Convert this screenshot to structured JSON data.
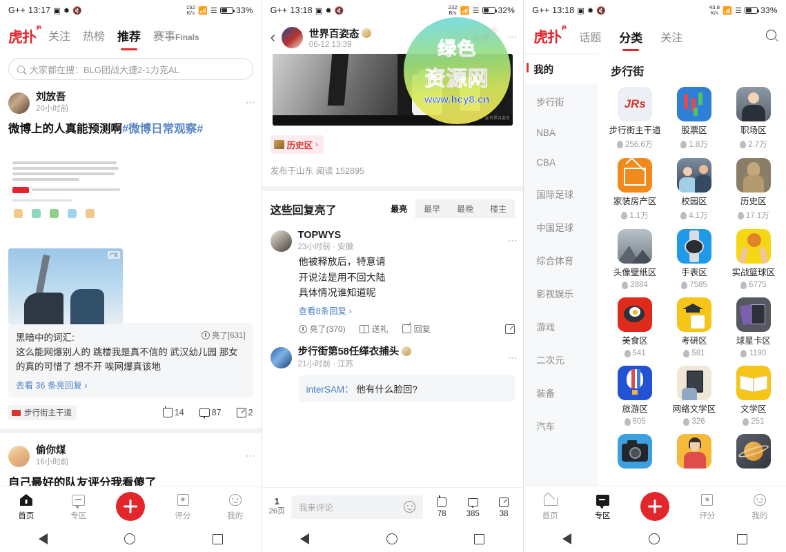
{
  "panel1": {
    "status": {
      "carrier": "G++",
      "time": "13:17",
      "net_rate": "152",
      "net_unit": "K/s",
      "battery": "33%"
    },
    "logo": {
      "text": "虎扑",
      "sup": "JR"
    },
    "tabs": [
      {
        "label": "关注",
        "active": false
      },
      {
        "label": "热榜",
        "active": false
      },
      {
        "label": "推荐",
        "active": true
      },
      {
        "label": "赛事",
        "suffix": "Finals",
        "active": false
      }
    ],
    "search": {
      "placeholder": "大家都在搜：BLG团战大捷2-1力克AL"
    },
    "post": {
      "author": "刘放吾",
      "time": "20小时前",
      "title_main": "微博上的人真能预测啊",
      "title_tag": "#微博日常观察#",
      "quote_name": "黑暗中的词汇:",
      "quote_bright": "亮了[631]",
      "quote_text": "这么能网爆别人的 跳楼我是真不信的 武汉幼儿园 那女的真的可惜了 想不开 唉网爆真该地",
      "quote_more": "去看 36 条亮回复 ",
      "zone": "步行街主干道",
      "likes": "14",
      "comments": "87",
      "shares": "2"
    },
    "post2": {
      "author": "偷你煤",
      "time": "16小时前",
      "title": "自己最好的队友评分我看傻了"
    },
    "nav": [
      {
        "label": "首页",
        "icon": "home-icon",
        "active": true
      },
      {
        "label": "专区",
        "icon": "zone-icon",
        "active": false
      },
      {
        "label": "",
        "icon": "plus-icon",
        "active": false
      },
      {
        "label": "评分",
        "icon": "star-icon",
        "active": false
      },
      {
        "label": "我的",
        "icon": "profile-icon",
        "active": false
      }
    ]
  },
  "panel2": {
    "status": {
      "carrier": "G++",
      "time": "13:18",
      "net_rate": "232",
      "net_unit": "B/s",
      "battery": "32%"
    },
    "header": {
      "author": "世界百姿态",
      "time": "06-12 13:39",
      "follow": "＋ 关注"
    },
    "zone_chip": "历史区",
    "meta": "发布于山东  阅读 152895",
    "comments_title": "这些回复亮了",
    "sorts": [
      {
        "label": "最亮",
        "active": true
      },
      {
        "label": "最早",
        "active": false
      },
      {
        "label": "最晚",
        "active": false
      },
      {
        "label": "楼主",
        "active": false
      }
    ],
    "comment1": {
      "user": "TOPWYS",
      "meta": "23小时前 · 安徽",
      "line1": "他被释放后，特意请",
      "line2": "开说法是用不回大陆",
      "line3": "具体情况谁知道呢",
      "more": "查看8条回复 ",
      "bright": "亮了(370)",
      "gift": "送礼",
      "reply": "回复"
    },
    "comment2": {
      "user": "步行街第58任缂衣捕头",
      "meta": "21小时前 · 江苏",
      "quote_user": "interSAM：",
      "quote_text": "他有什么脸回?"
    },
    "watermark": {
      "line1": "绿色",
      "line2": "资源网",
      "line3": "www.hcy8.cn"
    },
    "bottom": {
      "page": "1",
      "page_total": "26页",
      "input_placeholder": "我来评论",
      "likes": "78",
      "comments": "385",
      "shares": "38"
    }
  },
  "panel3": {
    "status": {
      "carrier": "G++",
      "time": "13:18",
      "net_rate": "43.8",
      "net_unit": "K/s",
      "battery": "33%"
    },
    "logo": {
      "text": "虎扑",
      "sup": "JR"
    },
    "tabs": [
      {
        "label": "话题",
        "active": false
      },
      {
        "label": "分类",
        "active": true
      },
      {
        "label": "关注",
        "active": false
      }
    ],
    "sidebar_header": "我的",
    "sidebar": [
      "步行街",
      "NBA",
      "CBA",
      "国际足球",
      "中国足球",
      "综合体育",
      "影视娱乐",
      "游戏",
      "二次元",
      "装备",
      "汽车"
    ],
    "section_title": "步行街",
    "categories": [
      {
        "name": "步行街主干道",
        "count": "256.6万",
        "icon": "jrs-icon"
      },
      {
        "name": "股票区",
        "count": "1.8万",
        "icon": "stock-icon"
      },
      {
        "name": "职场区",
        "count": "2.7万",
        "icon": "workplace-icon"
      },
      {
        "name": "家装房产区",
        "count": "1.1万",
        "icon": "house-icon"
      },
      {
        "name": "校园区",
        "count": "4.1万",
        "icon": "campus-icon"
      },
      {
        "name": "历史区",
        "count": "17.1万",
        "icon": "history-icon"
      },
      {
        "name": "头像壁纸区",
        "count": "2884",
        "icon": "wallpaper-icon"
      },
      {
        "name": "手表区",
        "count": "7585",
        "icon": "watch-icon"
      },
      {
        "name": "实战篮球区",
        "count": "6775",
        "icon": "basketball-icon"
      },
      {
        "name": "美食区",
        "count": "541",
        "icon": "food-icon"
      },
      {
        "name": "考研区",
        "count": "581",
        "icon": "exam-icon"
      },
      {
        "name": "球星卡区",
        "count": "1190",
        "icon": "card-icon"
      },
      {
        "name": "旅游区",
        "count": "605",
        "icon": "travel-icon"
      },
      {
        "name": "网络文学区",
        "count": "326",
        "icon": "ebook-icon"
      },
      {
        "name": "文学区",
        "count": "251",
        "icon": "book-icon"
      },
      {
        "name": "",
        "count": "",
        "icon": "camera-icon"
      },
      {
        "name": "",
        "count": "",
        "icon": "person-icon"
      },
      {
        "name": "",
        "count": "",
        "icon": "planet-icon"
      }
    ],
    "nav": [
      {
        "label": "首页",
        "icon": "home-icon",
        "active": false
      },
      {
        "label": "专区",
        "icon": "zone-icon",
        "active": true
      },
      {
        "label": "",
        "icon": "plus-icon",
        "active": false
      },
      {
        "label": "评分",
        "icon": "star-icon",
        "active": false
      },
      {
        "label": "我的",
        "icon": "profile-icon",
        "active": false
      }
    ]
  }
}
